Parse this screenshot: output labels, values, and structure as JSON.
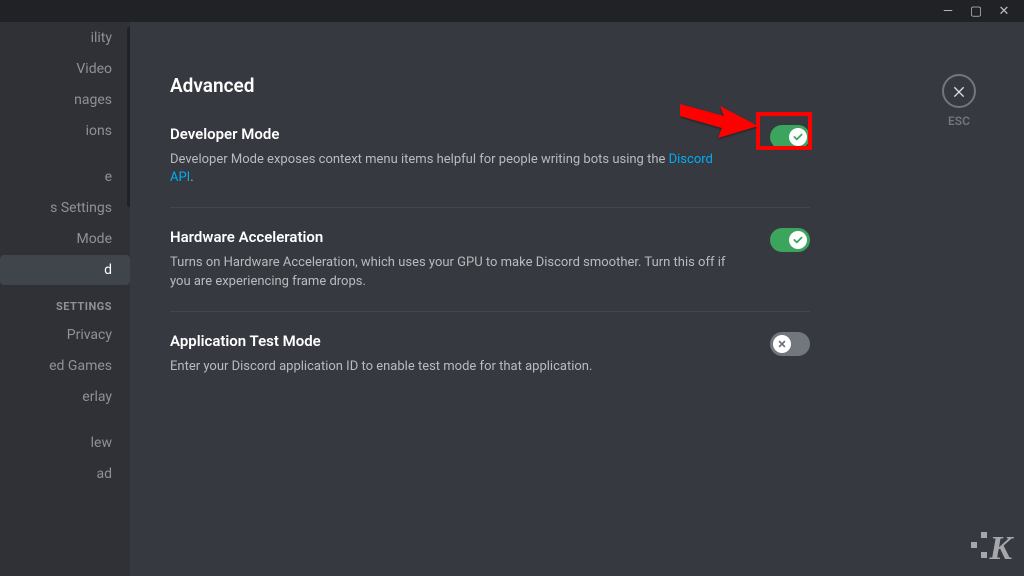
{
  "titlebar": {
    "min": "—",
    "max": "▢",
    "close": "✕"
  },
  "sidebar": {
    "items": [
      "ility",
      "Video",
      "nages",
      "ions",
      "",
      "e",
      "s Settings",
      " Mode",
      "d"
    ],
    "active_index": 8,
    "section_header": "SETTINGS",
    "items2": [
      "Privacy",
      "ed Games",
      "erlay",
      "lew",
      "ad"
    ]
  },
  "page": {
    "title": "Advanced",
    "esc_label": "ESC"
  },
  "settings": [
    {
      "title": "Developer Mode",
      "desc_prefix": "Developer Mode exposes context menu items helpful for people writing bots using the ",
      "link_text": "Discord API",
      "desc_suffix": ".",
      "on": true,
      "highlighted": true
    },
    {
      "title": "Hardware Acceleration",
      "desc": "Turns on Hardware Acceleration, which uses your GPU to make Discord smoother. Turn this off if you are experiencing frame drops.",
      "on": true
    },
    {
      "title": "Application Test Mode",
      "desc": "Enter your Discord application ID to enable test mode for that application.",
      "on": false
    }
  ],
  "watermark": "K"
}
